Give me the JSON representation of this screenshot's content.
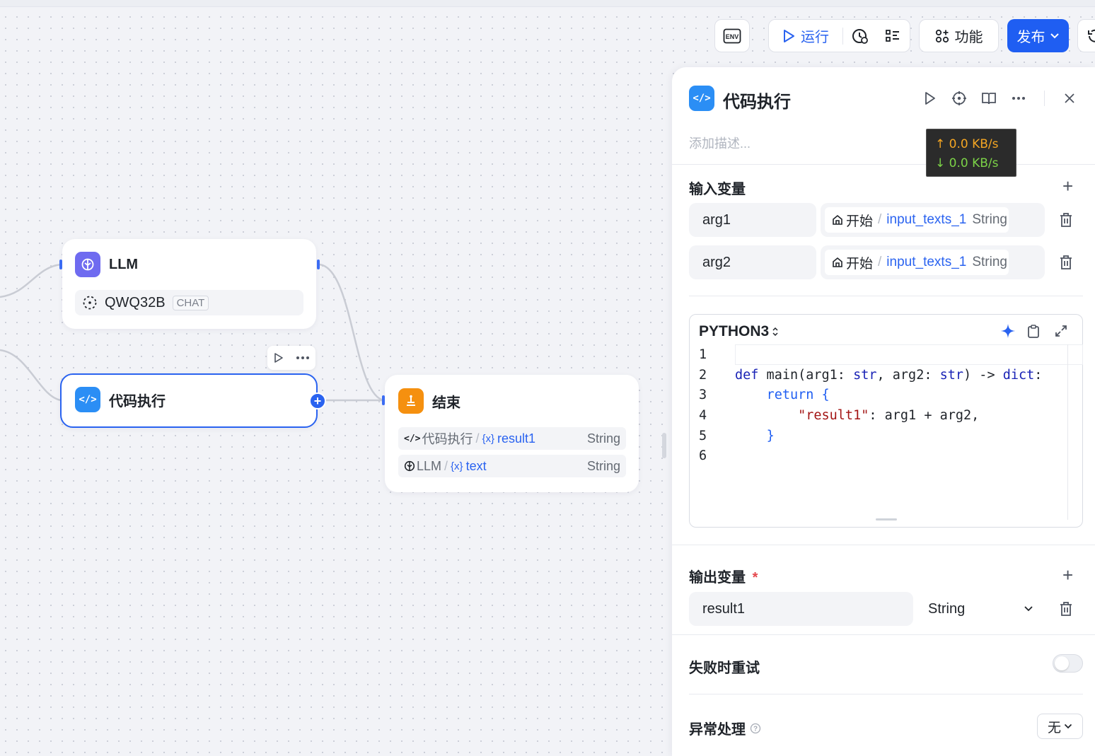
{
  "toolbar": {
    "env_label": "ENV",
    "run_label": "运行",
    "features_label": "功能",
    "publish_label": "发布"
  },
  "nodes": {
    "llm": {
      "title": "LLM",
      "model": "QWQ32B",
      "badge": "CHAT"
    },
    "code": {
      "title": "代码执行"
    },
    "end": {
      "title": "结束",
      "rows": [
        {
          "source": "代码执行",
          "var_icon": "{x}",
          "var": "result1",
          "type": "String"
        },
        {
          "source": "LLM",
          "var_icon": "{x}",
          "var": "text",
          "type": "String"
        }
      ]
    }
  },
  "panel": {
    "title": "代码执行",
    "description_placeholder": "添加描述...",
    "inputs_title": "输入变量",
    "inputs": [
      {
        "name": "arg1",
        "source": "开始",
        "var": "input_texts_1",
        "type": "String"
      },
      {
        "name": "arg2",
        "source": "开始",
        "var": "input_texts_1",
        "type": "String"
      }
    ],
    "code": {
      "language": "PYTHON3",
      "line_numbers": [
        "1",
        "2",
        "3",
        "4",
        "5",
        "6"
      ],
      "line2": {
        "kw": "def",
        "fn": " main(arg1: ",
        "t1": "str",
        "m1": ", arg2: ",
        "t2": "str",
        "m2": ") -> ",
        "t3": "dict",
        "end": ":"
      },
      "line3": {
        "indent": "    ",
        "kw": "return",
        "rest": " {"
      },
      "line4": {
        "indent": "        ",
        "str": "\"result1\"",
        "rest": ": arg1 + arg2,"
      },
      "line5": {
        "indent": "    ",
        "rest": "}"
      }
    },
    "outputs_title": "输出变量",
    "required_mark": "*",
    "outputs": [
      {
        "name": "result1",
        "type": "String"
      }
    ],
    "retry_label": "失败时重试",
    "retry_enabled": false,
    "exception_label": "异常处理",
    "exception_value": "无"
  },
  "network_overlay": {
    "up": "↑ 0.0 KB/s",
    "down": "↓ 0.0 KB/s"
  },
  "colors": {
    "accent": "#1f5ef2",
    "llm_icon": "#6f6bf0",
    "code_icon": "#2b8ef5",
    "end_icon": "#f5900f"
  }
}
